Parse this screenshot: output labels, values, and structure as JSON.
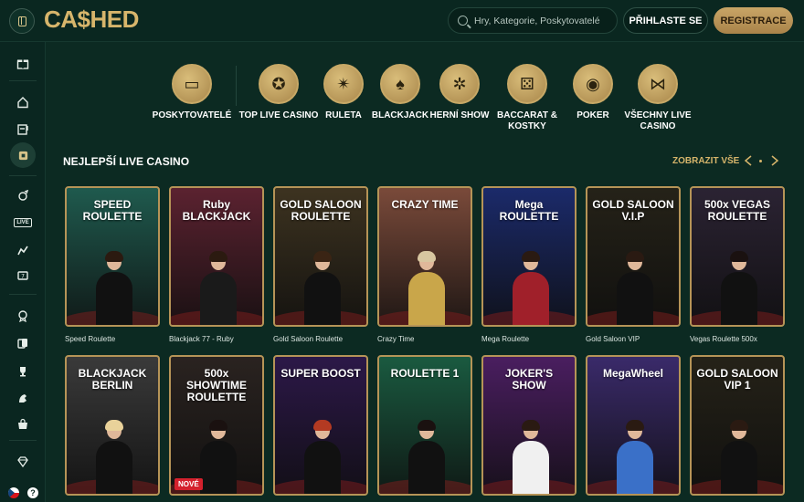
{
  "header": {
    "logo": "CA$HED",
    "search_placeholder": "Hry, Kategorie, Poskytovatelé",
    "login_label": "PŘIHLASTE SE",
    "register_label": "REGISTRACE"
  },
  "sidebar": {
    "items": [
      {
        "icon": "gift-icon",
        "glyph": "🎁"
      },
      {
        "icon": "home-icon",
        "glyph": "⌂"
      },
      {
        "icon": "slot-machine-icon",
        "glyph": "▤"
      },
      {
        "icon": "live-casino-icon",
        "glyph": "◧"
      },
      {
        "icon": "crash-games-icon",
        "glyph": "✸"
      },
      {
        "icon": "live-icon",
        "glyph": "LIVE"
      },
      {
        "icon": "chart-icon",
        "glyph": "◭"
      },
      {
        "icon": "jackpot-icon",
        "glyph": "▣"
      },
      {
        "icon": "award-icon",
        "glyph": "✪"
      },
      {
        "icon": "cards-icon",
        "glyph": "▦"
      },
      {
        "icon": "trophy-icon",
        "glyph": "♛"
      },
      {
        "icon": "horse-icon",
        "glyph": "♞"
      },
      {
        "icon": "shop-icon",
        "glyph": "◼"
      },
      {
        "icon": "diamond-icon",
        "glyph": "◆"
      }
    ],
    "help_label": "?"
  },
  "categories": [
    {
      "label": "POSKYTOVATELÉ",
      "glyph": "▭",
      "icon": "providers-icon"
    },
    {
      "label": "TOP LIVE CASINO",
      "glyph": "✪",
      "icon": "top-live-icon"
    },
    {
      "label": "RULETA",
      "glyph": "✴",
      "icon": "roulette-icon"
    },
    {
      "label": "BLACKJACK",
      "glyph": "♠",
      "icon": "blackjack-icon"
    },
    {
      "label": "HERNÍ SHOW",
      "glyph": "✲",
      "icon": "game-show-icon"
    },
    {
      "label": "BACCARAT & KOSTKY",
      "glyph": "⚄",
      "icon": "dice-icon"
    },
    {
      "label": "POKER",
      "glyph": "◉",
      "icon": "poker-chip-icon"
    },
    {
      "label": "VŠECHNY LIVE CASINO",
      "glyph": "⋈",
      "icon": "all-live-icon"
    }
  ],
  "section": {
    "title": "NEJLEPŠÍ LIVE CASINO",
    "show_all": "ZOBRAZIT VŠE"
  },
  "games_row1": [
    {
      "name": "Speed Roulette",
      "brand": "SPEED ROULETTE",
      "bg": "#1f5a4e",
      "suit": "#111",
      "hair": "#2b1a10"
    },
    {
      "name": "Blackjack 77 - Ruby",
      "brand": "Ruby BLACKJACK",
      "bg": "#5b2230",
      "suit": "#1a1a1a",
      "hair": "#2b1a10"
    },
    {
      "name": "Gold Saloon Roulette",
      "brand": "GOLD SALOON ROULETTE",
      "bg": "#3d3320",
      "suit": "#111",
      "hair": "#3a2414"
    },
    {
      "name": "Crazy Time",
      "brand": "CRAZY TIME",
      "bg": "#7a4a3a",
      "suit": "#c9a64a",
      "hair": "#d8c6a0"
    },
    {
      "name": "Mega Roulette",
      "brand": "Mega ROULETTE",
      "bg": "#1b2a6a",
      "suit": "#a0202a",
      "hair": "#2a1a12"
    },
    {
      "name": "Gold Saloon VIP",
      "brand": "GOLD SALOON V.I.P",
      "bg": "#252218",
      "suit": "#111",
      "hair": "#2a1a12"
    },
    {
      "name": "Vegas Roulette 500x",
      "brand": "500x VEGAS ROULETTE",
      "bg": "#2b2333",
      "suit": "#111",
      "hair": "#1a1110"
    }
  ],
  "games_row2": [
    {
      "name": "Blackjack Berlin",
      "brand": "BLACKJACK BERLIN",
      "bg": "#3a3a3a",
      "suit": "#111",
      "hair": "#e9d29a"
    },
    {
      "name": "Showtime Roulette",
      "brand": "500x SHOWTIME ROULETTE",
      "bg": "#2a2320",
      "suit": "#111",
      "hair": "#1a1110",
      "badge": "NOVÉ"
    },
    {
      "name": "Super Boost",
      "brand": "SUPER BOOST",
      "bg": "#2c1848",
      "suit": "#111",
      "hair": "#b33a22"
    },
    {
      "name": "Roulette 1",
      "brand": "ROULETTE 1",
      "bg": "#1a5a40",
      "suit": "#111",
      "hair": "#1a1110"
    },
    {
      "name": "Joker's Show",
      "brand": "JOKER'S SHOW",
      "bg": "#4a1e60",
      "suit": "#f0f0f0",
      "hair": "#2a1a12"
    },
    {
      "name": "Mega Wheel",
      "brand": "MegaWheel",
      "bg": "#3a2a6a",
      "suit": "#3a70c8",
      "hair": "#2a1a12"
    },
    {
      "name": "Gold Saloon VIP 1",
      "brand": "GOLD SALOON VIP 1",
      "bg": "#252218",
      "suit": "#111",
      "hair": "#2a1a12"
    }
  ]
}
